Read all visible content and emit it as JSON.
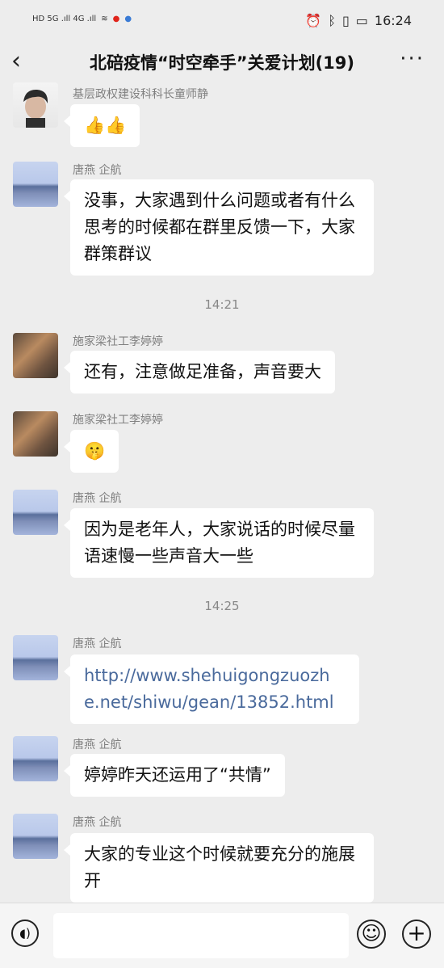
{
  "status_bar": {
    "left_indicators": "HD 5G .ıll 4G .ıll",
    "time": "16:24"
  },
  "navbar": {
    "title": "北碚疫情“时空牵手”关爱计划(19)",
    "back_icon": "chevron-left-icon",
    "more_label": "···"
  },
  "messages": [
    {
      "sender": "基层政权建设科科长童师静",
      "text": "👍👍"
    },
    {
      "sender": "唐燕 企航",
      "text": "没事，大家遇到什么问题或者有什么思考的时候都在群里反馈一下，大家群策群议"
    },
    {
      "time": "14:21"
    },
    {
      "sender": "施家梁社工李婷婷",
      "text": "还有，注意做足准备，声音要大"
    },
    {
      "sender": "施家梁社工李婷婷",
      "text": "🤫"
    },
    {
      "sender": "唐燕 企航",
      "text": "因为是老年人，大家说话的时候尽量语速慢一些声音大一些"
    },
    {
      "time": "14:25"
    },
    {
      "sender": "唐燕 企航",
      "text": "http://www.shehuigongzuozhe.net/shiwu/gean/13852.html"
    },
    {
      "sender": "唐燕 企航",
      "text": "婷婷昨天还运用了“共情”"
    },
    {
      "sender": "唐燕 企航",
      "text": "大家的专业这个时候就要充分的施展开"
    }
  ],
  "input_bar": {
    "voice_icon": "voice-icon",
    "emoji_icon": "emoji-icon",
    "plus_icon": "plus-icon",
    "placeholder": ""
  }
}
